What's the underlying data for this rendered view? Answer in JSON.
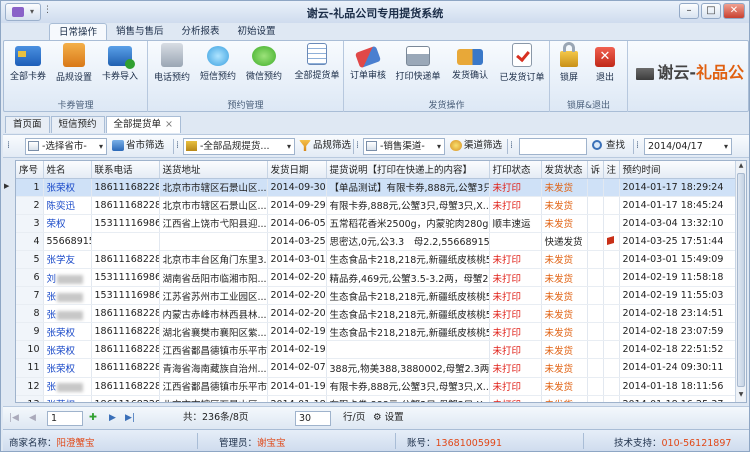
{
  "window": {
    "title": "谢云-礼品公司专用提货系统"
  },
  "ribbon_tabs": [
    "日常操作",
    "销售与售后",
    "分析报表",
    "初始设置"
  ],
  "ribbon_groups": [
    {
      "label": "卡券管理",
      "buttons": [
        "全部卡券",
        "品规设置",
        "卡券导入"
      ]
    },
    {
      "label": "预约管理",
      "buttons": [
        "电话预约",
        "短信预约",
        "微信预约",
        "全部提货单"
      ]
    },
    {
      "label": "发货操作",
      "buttons": [
        "订单审核",
        "打印快递单",
        "发货确认",
        "已发货订单"
      ]
    },
    {
      "label": "锁屏&退出",
      "buttons": [
        "锁屏",
        "退出"
      ]
    }
  ],
  "logo": {
    "prefix": "谢云-",
    "suffix": "礼品公"
  },
  "doc_tabs": [
    "首页面",
    "短信预约",
    "全部提货单"
  ],
  "filters": {
    "province": "-选择省市-",
    "province_btn": "省市筛选",
    "product": "-全部品规提货...",
    "product_btn": "品规筛选",
    "channel": "-销售渠道-",
    "channel_btn": "渠道筛选",
    "search_value": "",
    "search_btn": "查找",
    "date": "2014/04/17"
  },
  "table": {
    "columns": [
      "序号",
      "姓名",
      "联系电话",
      "送货地址",
      "发货日期",
      "提货说明【打印在快递上的内容】",
      "打印状态",
      "发货状态",
      "诉",
      "注",
      "预约时间"
    ],
    "rows": [
      [
        "1",
        "张荣权",
        "18611168228",
        "北京市市辖区石景山区...",
        "2014-09-30",
        "【单品测试】有限卡券,888元,公蟹3只...",
        "未打印",
        "未发货",
        "",
        "",
        "2014-01-17 18:29:24"
      ],
      [
        "2",
        "陈奕迅",
        "18611168228",
        "北京市市辖区石景山区...",
        "2014-09-29",
        "有限卡券,888元,公蟹3只,母蟹3只,X...",
        "未打印",
        "未发货",
        "",
        "",
        "2014-01-17 18:45:24"
      ],
      [
        "3",
        "荣权",
        "15311116986",
        "江西省上饶市弋阳县迎...",
        "2014-06-05",
        "五常稻花香米2500g，内蒙驼肉280g...",
        "顺丰速运",
        "未发货",
        "",
        "",
        "2014-03-04 13:32:10"
      ],
      [
        "4",
        "55668915",
        "",
        "",
        "2014-03-25",
        "思密达,0元,公3.3　母2.2,55668915,1...",
        "",
        "快递发货",
        "",
        "flag",
        "2014-03-25 17:51:44"
      ],
      [
        "5",
        "张学友",
        "18611168228",
        "北京市丰台区角门东里3...",
        "2014-03-01",
        "生态食品卡218,218元,新疆纸皮核桃5...",
        "未打印",
        "未发货",
        "",
        "",
        "2014-03-01 15:49:09"
      ],
      [
        "6",
        "刘",
        "15311116986",
        "湖南省岳阳市临湘市阳...",
        "2014-02-20",
        "精品券,469元,公蟹3.5-3.2两，母蟹2...",
        "未打印",
        "未发货",
        "",
        "",
        "2014-02-19 11:58:18"
      ],
      [
        "7",
        "张",
        "15311116986",
        "江苏省苏州市工业园区...",
        "2014-02-20",
        "生态食品卡218,218元,新疆纸皮核桃5...",
        "未打印",
        "未发货",
        "",
        "",
        "2014-02-19 11:55:03"
      ],
      [
        "8",
        "张",
        "18611168228",
        "内蒙古赤峰市林西县林...",
        "2014-02-20",
        "生态食品卡218,218元,新疆纸皮核桃5...",
        "未打印",
        "未发货",
        "",
        "",
        "2014-02-18 23:14:51"
      ],
      [
        "9",
        "张荣权",
        "18611168228",
        "湖北省襄樊市襄阳区紫...",
        "2014-02-19",
        "生态食品卡218,218元,新疆纸皮核桃5...",
        "未打印",
        "未发货",
        "",
        "",
        "2014-02-18 23:07:59"
      ],
      [
        "10",
        "张荣权",
        "18611168228",
        "江西省鄱昌德镇市乐平市...",
        "2014-02-19",
        "",
        "未打印",
        "未发货",
        "",
        "",
        "2014-02-18 22:51:52"
      ],
      [
        "11",
        "张荣权",
        "18611168228",
        "青海省海南藏族自治州...",
        "2014-02-07",
        "388元,物美388,3880002,母蟹2.3两X...",
        "未打印",
        "未发货",
        "",
        "",
        "2014-01-24 09:30:11"
      ],
      [
        "12",
        "张",
        "18611168228",
        "江西省鄱昌德镇市乐平市...",
        "2014-01-19",
        "有限卡券,888元,公蟹3只,母蟹3只,X...",
        "未打印",
        "未发货",
        "",
        "",
        "2014-01-18 18:11:56"
      ],
      [
        "13",
        "张荣权",
        "18611168228",
        "北京市市辖区石景山区...",
        "2014-01-18",
        "有限卡券,888元,公蟹3只,母蟹3只,X...",
        "未打印",
        "未发货",
        "",
        "",
        "2014-01-18 16:25:37"
      ]
    ]
  },
  "pager": {
    "page": "1",
    "summary": "共：236条/8页",
    "page_size": "30",
    "per_page_label": "行/页",
    "settings_label": "设置"
  },
  "status": {
    "merchant_label": "商家名称：",
    "merchant": "阳澄蟹宝",
    "admin_label": "管理员：",
    "admin": "谢宝宝",
    "account_label": "账号：",
    "account": "13681005991",
    "support_label": "技术支持：",
    "support": "010-56121897"
  },
  "colors": {
    "accent": "#e06010",
    "link": "#1848c8",
    "unprinted": "#e02018"
  }
}
